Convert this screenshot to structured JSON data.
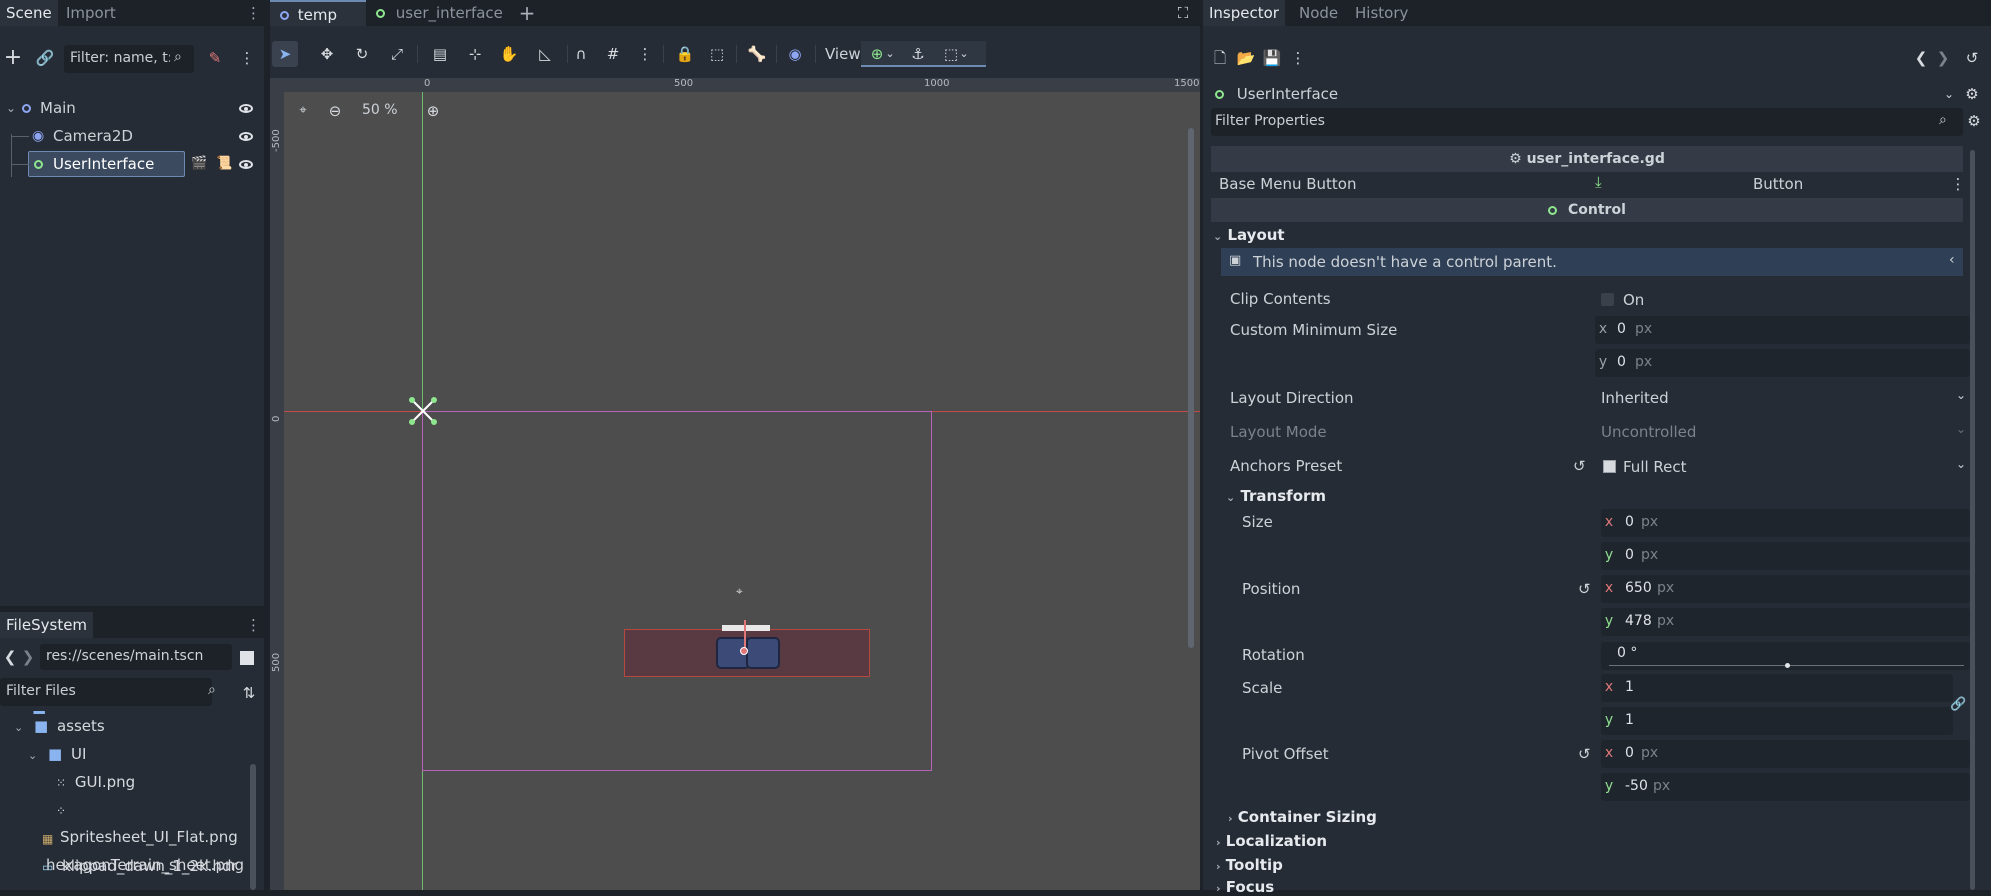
{
  "left_dock": {
    "tabs": [
      {
        "label": "Scene",
        "active": true
      },
      {
        "label": "Import",
        "active": false
      }
    ],
    "filter_placeholder": "Filter: name, t:t",
    "tree": [
      {
        "label": "Main",
        "icon": "node2d-icon"
      },
      {
        "label": "Camera2D",
        "icon": "camera2d-icon"
      },
      {
        "label": "UserInterface",
        "icon": "control-icon",
        "selected": true
      }
    ]
  },
  "filesystem": {
    "title": "FileSystem",
    "path": "res://scenes/main.tscn",
    "filter_placeholder": "Filter Files",
    "items": [
      {
        "label": "assets",
        "kind": "folder"
      },
      {
        "label": "UI",
        "kind": "folder"
      },
      {
        "label": "GUI.png",
        "kind": "image"
      },
      {
        "label": "Spritesheet_UI_Flat.png",
        "kind": "image"
      },
      {
        "label": "hexagonTerrain_sheet.png",
        "kind": "image"
      },
      {
        "label": "klippad_dawn_1_2k.hdr",
        "kind": "image"
      }
    ]
  },
  "editor": {
    "tabs": [
      {
        "label": "temp",
        "active": true
      },
      {
        "label": "user_interface",
        "active": false
      }
    ],
    "view_label": "View",
    "zoom": "50 %",
    "ruler_top": [
      "0",
      "500",
      "1000",
      "1500"
    ],
    "ruler_left": [
      "-500",
      "0",
      "500"
    ]
  },
  "inspector": {
    "tabs": [
      {
        "label": "Inspector",
        "active": true
      },
      {
        "label": "Node",
        "active": false
      },
      {
        "label": "History",
        "active": false
      }
    ],
    "node_name": "UserInterface",
    "filter_placeholder": "Filter Properties",
    "script_name": "user_interface.gd",
    "base_menu_label": "Base Menu Button",
    "base_menu_value": "Button",
    "control_header": "Control",
    "layout_header": "Layout",
    "warning": "This node doesn't have a control parent.",
    "props": {
      "clip_contents": "Clip Contents",
      "clip_contents_value": "On",
      "custom_min_size": "Custom Minimum Size",
      "cms_x": "0",
      "cms_y": "0",
      "layout_direction": "Layout Direction",
      "layout_direction_value": "Inherited",
      "layout_mode": "Layout Mode",
      "layout_mode_value": "Uncontrolled",
      "anchors_preset": "Anchors Preset",
      "anchors_preset_value": "Full Rect"
    },
    "transform": {
      "header": "Transform",
      "size_label": "Size",
      "size_x": "0",
      "size_y": "0",
      "position_label": "Position",
      "position_x": "650",
      "position_y": "478",
      "rotation_label": "Rotation",
      "rotation_value": "0 °",
      "rotation_fraction": 0.5,
      "scale_label": "Scale",
      "scale_x": "1",
      "scale_y": "1",
      "pivot_label": "Pivot Offset",
      "pivot_x": "0",
      "pivot_y": "-50"
    },
    "sections": [
      "Container Sizing",
      "Localization",
      "Tooltip",
      "Focus"
    ],
    "unit_px": "px",
    "axis_x": "x",
    "axis_y": "y"
  }
}
